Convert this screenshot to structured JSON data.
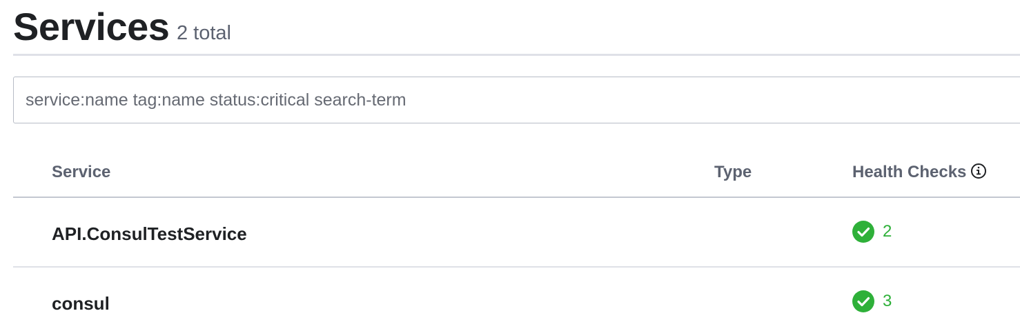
{
  "header": {
    "title": "Services",
    "count": "2 total"
  },
  "search": {
    "placeholder": "service:name tag:name status:critical search-term",
    "value": ""
  },
  "table": {
    "columns": [
      "Service",
      "Type",
      "Health Checks"
    ],
    "rows": [
      {
        "name": "API.ConsulTestService",
        "type": "",
        "health": {
          "status": "passing",
          "count": "2"
        }
      },
      {
        "name": "consul",
        "type": "",
        "health": {
          "status": "passing",
          "count": "3"
        }
      }
    ]
  },
  "colors": {
    "passing": "#2eb039",
    "title": "#1f2124",
    "muted": "#5c6270"
  },
  "icons": {
    "health_header": "info-circle-icon",
    "health_status": "check-circle-icon"
  }
}
